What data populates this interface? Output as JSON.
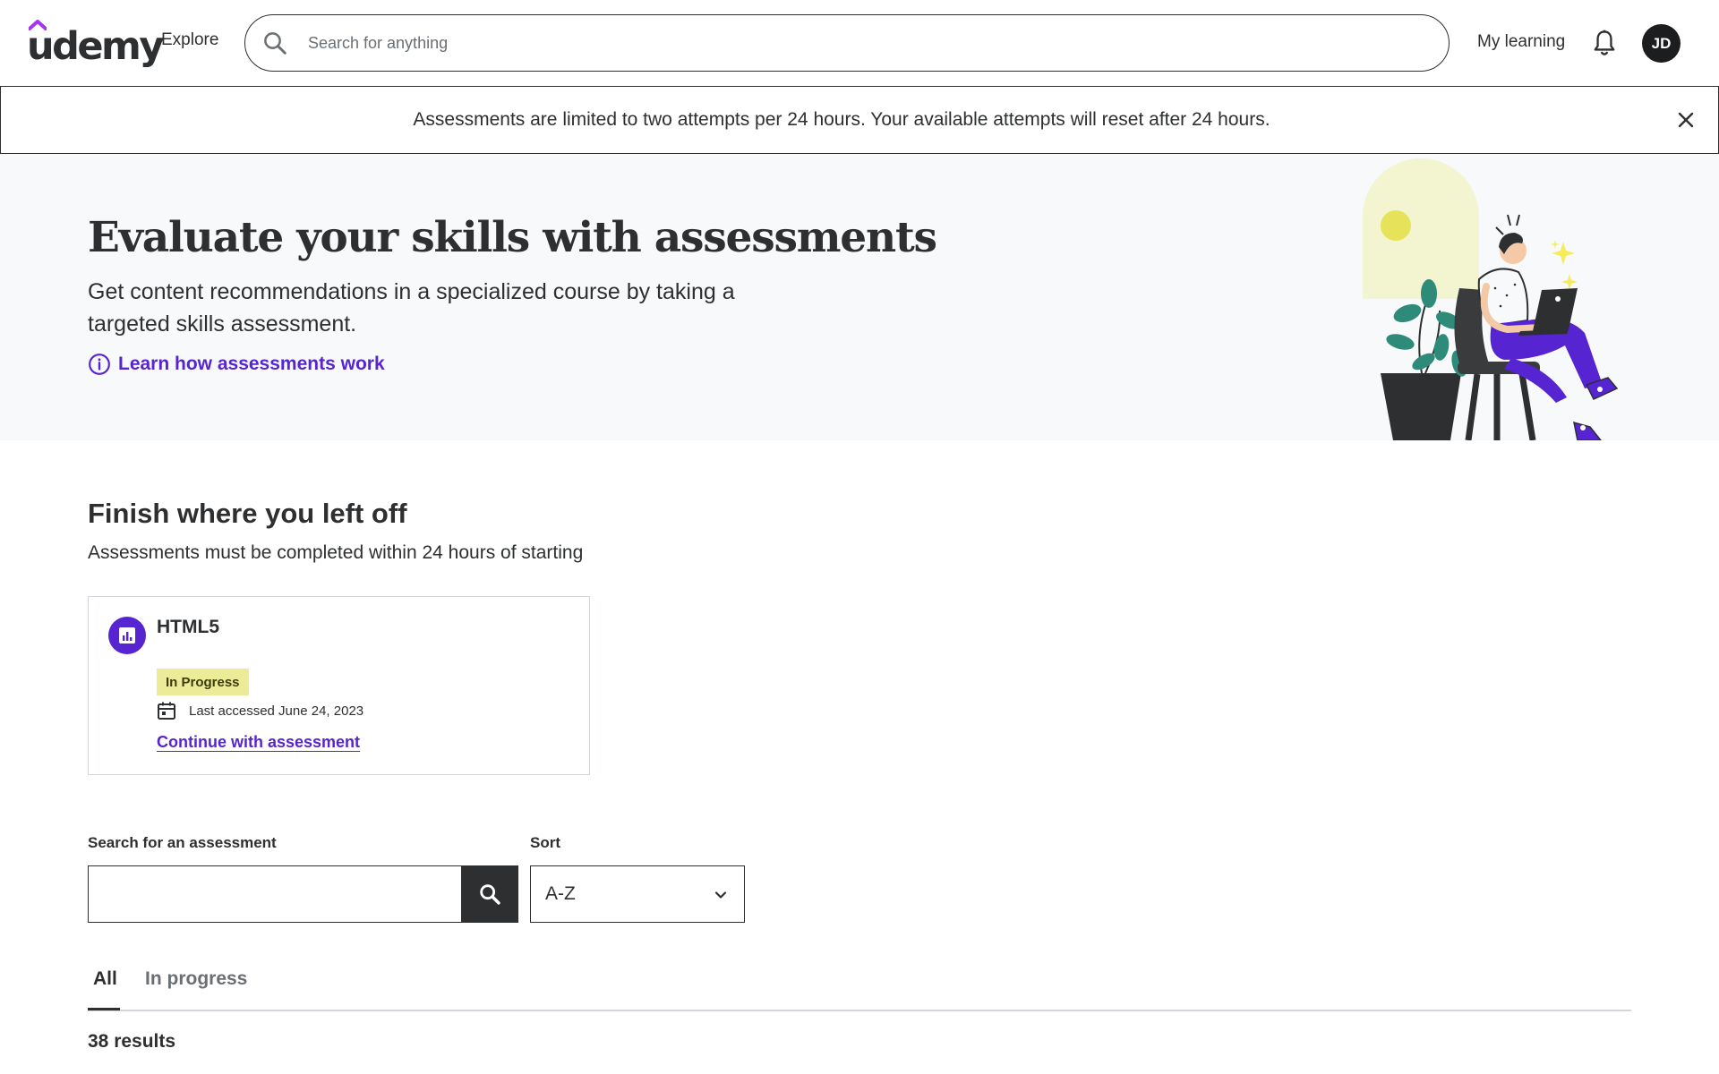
{
  "header": {
    "logo_text": "udemy",
    "explore_label": "Explore",
    "search_placeholder": "Search for anything",
    "my_learning_label": "My learning",
    "avatar_initials": "JD"
  },
  "banner": {
    "message": "Assessments are limited to two attempts per 24 hours. Your available attempts will reset after 24 hours."
  },
  "hero": {
    "title": "Evaluate your skills with assessments",
    "subtitle": "Get content recommendations in a specialized course by taking a targeted skills assessment.",
    "link_label": "Learn how assessments work"
  },
  "resume": {
    "title": "Finish where you left off",
    "subtitle": "Assessments must be completed within 24 hours of starting",
    "card": {
      "title": "HTML5",
      "status": "In Progress",
      "last_accessed": "Last accessed June 24, 2023",
      "action_label": "Continue with assessment"
    }
  },
  "filters": {
    "search_label": "Search for an assessment",
    "search_value": "",
    "sort_label": "Sort",
    "sort_value": "A-Z"
  },
  "tabs": [
    {
      "label": "All",
      "active": true
    },
    {
      "label": "In progress",
      "active": false
    }
  ],
  "results_text": "38 results",
  "colors": {
    "brand_purple": "#5624d0",
    "text_dark": "#2d2f31",
    "badge_yellow": "#eceb98",
    "hero_bg": "#f7f9fa"
  }
}
